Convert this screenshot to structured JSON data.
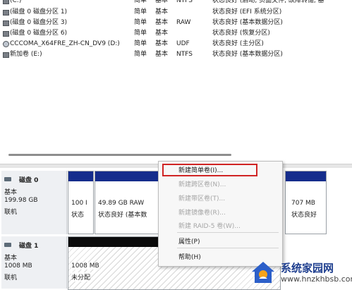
{
  "volumes": [
    {
      "name": "(C:)",
      "layout": "简单",
      "type": "基本",
      "fs": "NTFS",
      "status": "状态良好 (启动, 页面文件, 故障转储, 基"
    },
    {
      "name": "(磁盘 0 磁盘分区 1)",
      "layout": "简单",
      "type": "基本",
      "fs": "",
      "status": "状态良好 (EFI 系统分区)"
    },
    {
      "name": "(磁盘 0 磁盘分区 3)",
      "layout": "简单",
      "type": "基本",
      "fs": "RAW",
      "status": "状态良好 (基本数据分区)"
    },
    {
      "name": "(磁盘 0 磁盘分区 6)",
      "layout": "简单",
      "type": "基本",
      "fs": "",
      "status": "状态良好 (恢复分区)"
    },
    {
      "name": "CCCOMA_X64FRE_ZH-CN_DV9 (D:)",
      "layout": "简单",
      "type": "基本",
      "fs": "UDF",
      "status": "状态良好 (主分区)"
    },
    {
      "name": "新加卷 (E:)",
      "layout": "简单",
      "type": "基本",
      "fs": "NTFS",
      "status": "状态良好 (基本数据分区)"
    }
  ],
  "disks": [
    {
      "name": "磁盘 0",
      "type": "基本",
      "size": "199.98 GB",
      "state": "联机",
      "partitions": [
        {
          "line1": "100 I",
          "line2": "状态"
        },
        {
          "line1": "49.89 GB RAW",
          "line2": "状态良好 (基本数"
        },
        {
          "line1": "707 MB",
          "line2": "状态良好"
        }
      ]
    },
    {
      "name": "磁盘 1",
      "type": "基本",
      "size": "1008 MB",
      "state": "联机",
      "partitions": [
        {
          "line1": "1008 MB",
          "line2": "未分配"
        }
      ]
    }
  ],
  "context_menu": {
    "new_simple": "新建简单卷(I)...",
    "new_spanned": "新建跨区卷(N)...",
    "new_striped": "新建带区卷(T)...",
    "new_mirrored": "新建镜像卷(R)...",
    "new_raid5": "新建 RAID-5 卷(W)...",
    "properties": "属性(P)",
    "help": "帮助(H)"
  },
  "watermark": {
    "text": "系统家园网",
    "url": "www.hnzkhbsb.com"
  },
  "colors": {
    "partition_bar": "#152d8c",
    "unallocated_bar": "#0b0b0b",
    "highlight_border": "#d02424"
  }
}
